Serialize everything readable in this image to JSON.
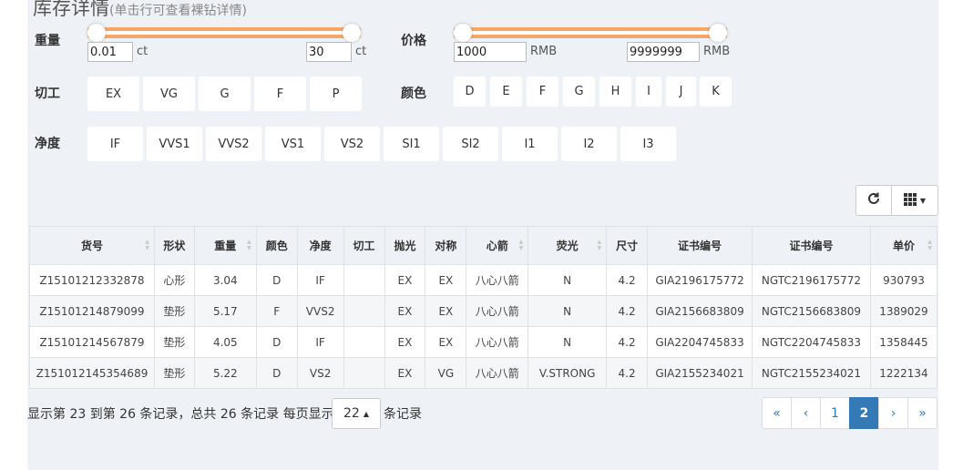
{
  "header": {
    "title": "库存详情",
    "subtitle": "(单击行可查看裸钻详情)"
  },
  "filters": {
    "weight": {
      "label": "重量",
      "min": "0.01",
      "max": "30",
      "unit": "ct"
    },
    "price": {
      "label": "价格",
      "min": "1000",
      "max": "9999999",
      "unit": "RMB"
    },
    "cut": {
      "label": "切工",
      "options": [
        "EX",
        "VG",
        "G",
        "F",
        "P"
      ]
    },
    "color": {
      "label": "颜色",
      "options": [
        "D",
        "E",
        "F",
        "G",
        "H",
        "I",
        "J",
        "K"
      ]
    },
    "clarity": {
      "label": "净度",
      "options": [
        "IF",
        "VVS1",
        "VVS2",
        "VS1",
        "VS2",
        "SI1",
        "SI2",
        "I1",
        "I2",
        "I3"
      ]
    }
  },
  "toolbar": {
    "refresh_icon": "refresh-icon",
    "columns_icon": "grid-columns-icon"
  },
  "table": {
    "headers": [
      "货号",
      "形状",
      "重量",
      "颜色",
      "净度",
      "切工",
      "抛光",
      "对称",
      "心箭",
      "荧光",
      "尺寸",
      "证书编号",
      "证书编号",
      "单价"
    ],
    "rows": [
      [
        "Z15101212332878",
        "心形",
        "3.04",
        "D",
        "IF",
        "",
        "EX",
        "EX",
        "八心八箭",
        "N",
        "4.2",
        "GIA2196175772",
        "NGTC2196175772",
        "930793"
      ],
      [
        "Z15101214879099",
        "垫形",
        "5.17",
        "F",
        "VVS2",
        "",
        "EX",
        "EX",
        "八心八箭",
        "N",
        "4.2",
        "GIA2156683809",
        "NGTC2156683809",
        "1389029"
      ],
      [
        "Z15101214567879",
        "垫形",
        "4.05",
        "D",
        "IF",
        "",
        "EX",
        "EX",
        "八心八箭",
        "N",
        "4.2",
        "GIA2204745833",
        "NGTC2204745833",
        "1358445"
      ],
      [
        "Z151012145354689",
        "垫形",
        "5.22",
        "D",
        "VS2",
        "",
        "EX",
        "VG",
        "八心八箭",
        "V.STRONG",
        "4.2",
        "GIA2155234021",
        "NGTC2155234021",
        "1222134"
      ]
    ]
  },
  "footer": {
    "info": "显示第 23 到第 26 条记录，总共 26 条记录 每页显示",
    "page_size": "22",
    "suffix": "条记录",
    "pages": [
      "«",
      "‹",
      "1",
      "2",
      "›",
      "»"
    ]
  }
}
